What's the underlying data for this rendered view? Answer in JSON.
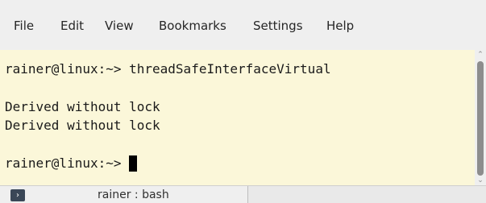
{
  "menu": {
    "items": [
      "File",
      "Edit",
      "View",
      "Bookmarks",
      "Settings",
      "Help"
    ]
  },
  "terminal": {
    "lines": [
      "rainer@linux:~> threadSafeInterfaceVirtual",
      "",
      "Derived without lock",
      "Derived without lock",
      "",
      "rainer@linux:~> "
    ],
    "background": "#fbf7d9",
    "cursor": "block"
  },
  "tab": {
    "label": "rainer : bash",
    "icon": "terminal-icon"
  }
}
